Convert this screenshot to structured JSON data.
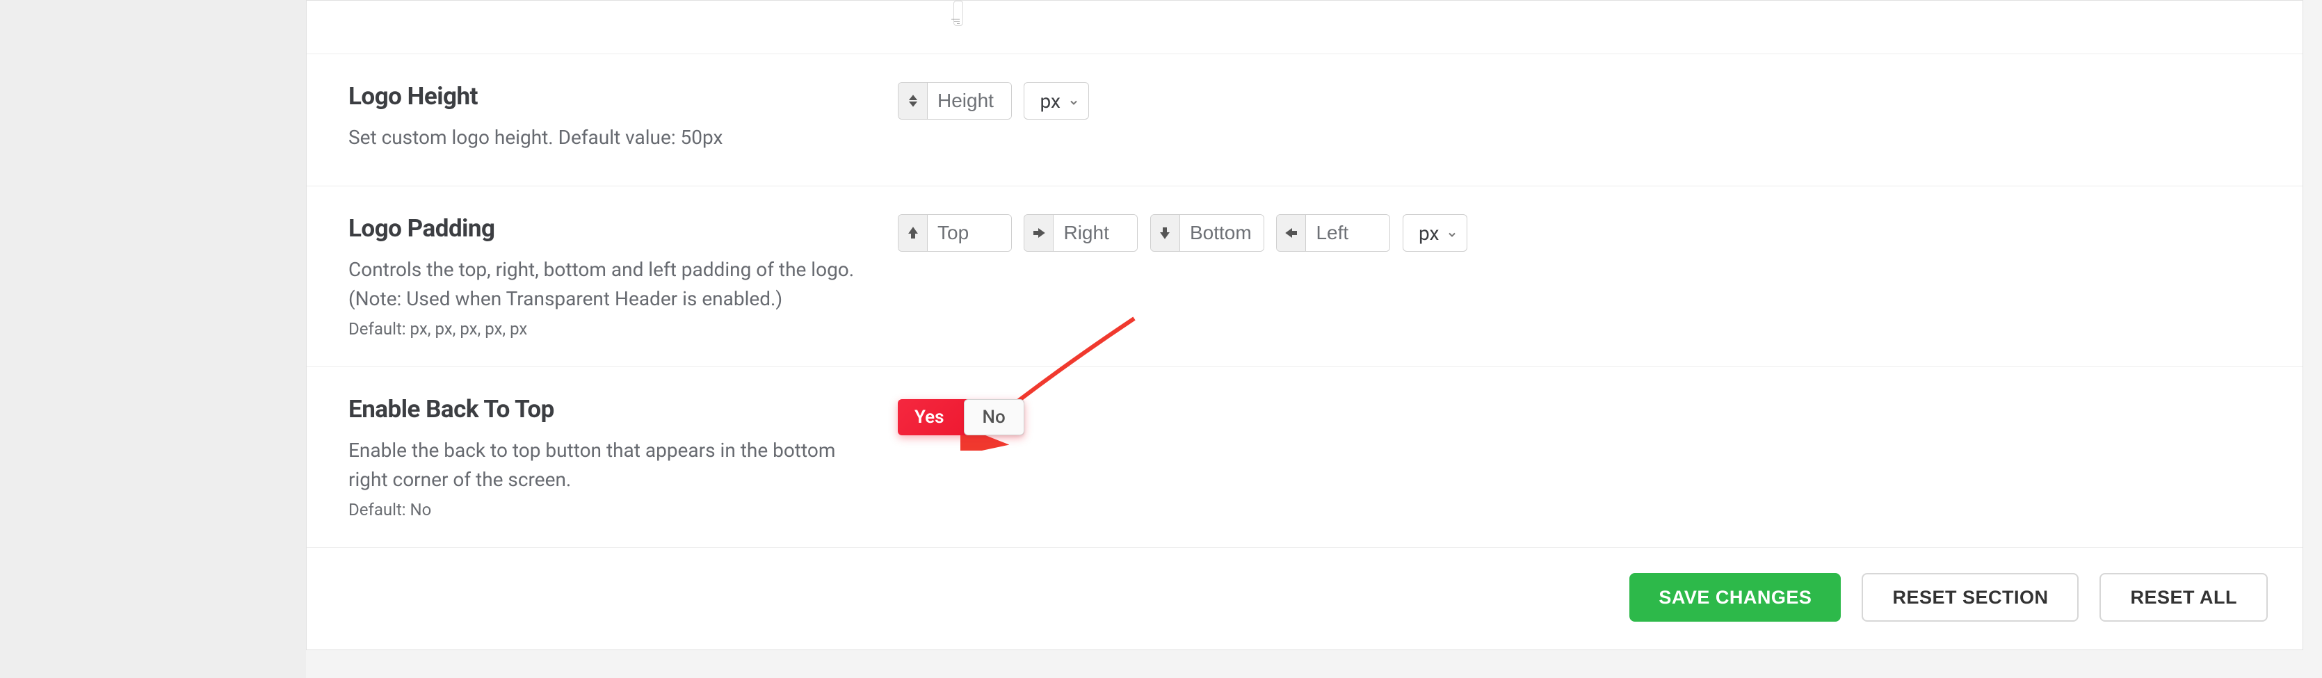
{
  "logo_height": {
    "title": "Logo Height",
    "desc": "Set custom logo height. Default value: 50px",
    "input_placeholder": "Height",
    "unit": "px"
  },
  "logo_padding": {
    "title": "Logo Padding",
    "desc": "Controls the top, right, bottom and left padding of the logo. (Note: Used when Transparent Header is enabled.)",
    "default_line": "Default: px, px, px, px, px",
    "top_ph": "Top",
    "right_ph": "Right",
    "bottom_ph": "Bottom",
    "left_ph": "Left",
    "unit": "px"
  },
  "back_to_top": {
    "title": "Enable Back To Top",
    "desc": "Enable the back to top button that appears in the bottom right corner of the screen.",
    "default_line": "Default: No",
    "yes_label": "Yes",
    "no_label": "No"
  },
  "footer": {
    "save": "SAVE CHANGES",
    "reset_section": "RESET SECTION",
    "reset_all": "RESET ALL"
  }
}
